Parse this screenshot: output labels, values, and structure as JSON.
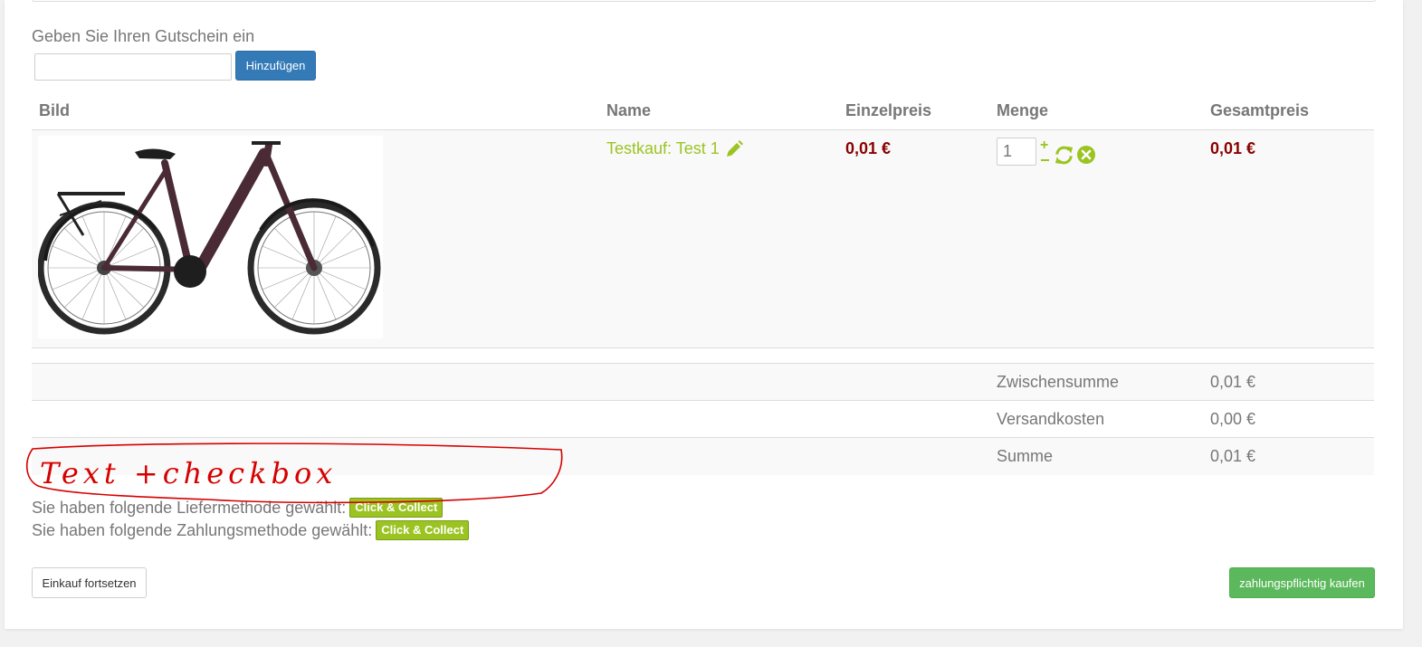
{
  "coupon": {
    "label": "Geben Sie Ihren Gutschein ein",
    "input_value": "",
    "button_label": "Hinzufügen"
  },
  "table": {
    "headers": {
      "image": "Bild",
      "name": "Name",
      "unit_price": "Einzelpreis",
      "quantity": "Menge",
      "total_price": "Gesamtpreis"
    },
    "item": {
      "name": "Testkauf: Test 1",
      "unit_price": "0,01 €",
      "quantity": "1",
      "total_price": "0,01 €",
      "plus": "+"
    }
  },
  "totals": {
    "subtotal_label": "Zwischensumme",
    "subtotal_value": "0,01 €",
    "shipping_label": "Versandkosten",
    "shipping_value": "0,00 €",
    "sum_label": "Summe",
    "sum_value": "0,01 €"
  },
  "methods": {
    "delivery_text": "Sie haben folgende Liefermethode gewählt:",
    "delivery_badge": "Click & Collect",
    "payment_text": "Sie haben folgende Zahlungsmethode gewählt:",
    "payment_badge": "Click & Collect"
  },
  "actions": {
    "continue_label": "Einkauf fortsetzen",
    "buy_label": "zahlungspflichtig kaufen"
  },
  "annotation": {
    "text": "Text +checkbox",
    "color": "#d60000"
  },
  "colors": {
    "accent_green": "#9bc423",
    "price_red": "#8b0000",
    "primary_blue": "#337ab7",
    "success_green": "#5cb85c"
  }
}
